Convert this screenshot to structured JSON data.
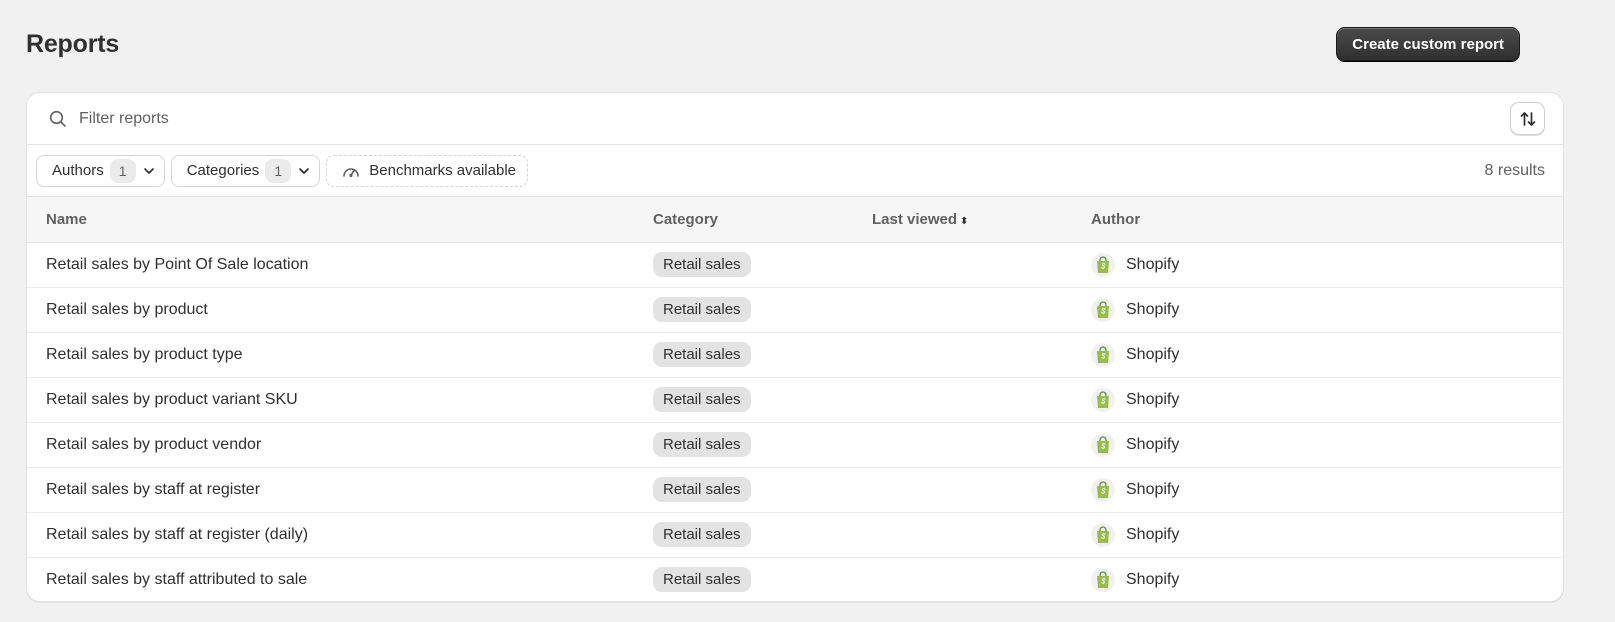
{
  "page": {
    "title": "Reports",
    "create_button": "Create custom report"
  },
  "search": {
    "placeholder": "Filter reports",
    "value": ""
  },
  "filters": {
    "authors_label": "Authors",
    "authors_count": "1",
    "categories_label": "Categories",
    "categories_count": "1",
    "benchmarks_label": "Benchmarks available",
    "results": "8 results"
  },
  "table": {
    "headers": {
      "name": "Name",
      "category": "Category",
      "last_viewed": "Last viewed",
      "author": "Author"
    },
    "rows": [
      {
        "name": "Retail sales by Point Of Sale location",
        "category": "Retail sales",
        "last_viewed": "",
        "author": "Shopify"
      },
      {
        "name": "Retail sales by product",
        "category": "Retail sales",
        "last_viewed": "",
        "author": "Shopify"
      },
      {
        "name": "Retail sales by product type",
        "category": "Retail sales",
        "last_viewed": "",
        "author": "Shopify"
      },
      {
        "name": "Retail sales by product variant SKU",
        "category": "Retail sales",
        "last_viewed": "",
        "author": "Shopify"
      },
      {
        "name": "Retail sales by product vendor",
        "category": "Retail sales",
        "last_viewed": "",
        "author": "Shopify"
      },
      {
        "name": "Retail sales by staff at register",
        "category": "Retail sales",
        "last_viewed": "",
        "author": "Shopify"
      },
      {
        "name": "Retail sales by staff at register (daily)",
        "category": "Retail sales",
        "last_viewed": "",
        "author": "Shopify"
      },
      {
        "name": "Retail sales by staff attributed to sale",
        "category": "Retail sales",
        "last_viewed": "",
        "author": "Shopify"
      }
    ]
  },
  "icons": {
    "search": "search-icon",
    "sort": "sort-arrows-icon",
    "chevron": "chevron-down-icon",
    "benchmark": "gauge-icon",
    "author_logo": "shopify-bag-icon"
  },
  "colors": {
    "primary_button": "#303030",
    "background": "#f1f1f1",
    "badge": "#e3e3e3",
    "shopify_green": "#95bf47"
  }
}
